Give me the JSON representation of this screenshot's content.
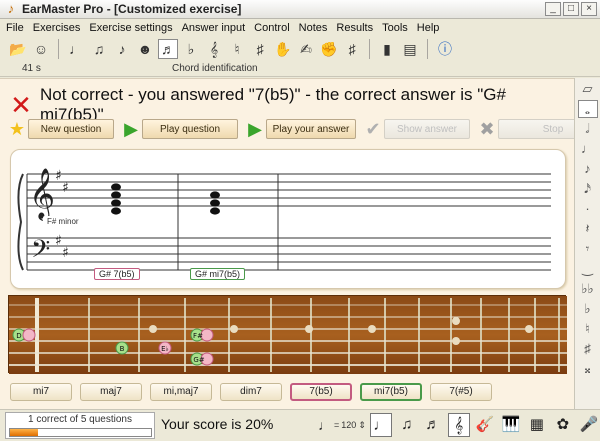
{
  "window": {
    "title": "EarMaster Pro - [Customized exercise]",
    "min": "_",
    "max": "□",
    "close": "×"
  },
  "menu": [
    "File",
    "Exercises",
    "Exercise settings",
    "Answer input",
    "Control",
    "Notes",
    "Results",
    "Tools",
    "Help"
  ],
  "toolbar": {
    "time": "41 s",
    "mode": "Chord identification"
  },
  "status": {
    "message": "Not correct - you answered \"7(b5)\" - the correct answer is \"G# mi7(b5)\""
  },
  "actions": {
    "new_question": "New question",
    "play_question": "Play question",
    "play_answer": "Play your answer",
    "show_answer": "Show answer",
    "stop": "Stop"
  },
  "staff": {
    "key_label": "F# minor",
    "chord_labels": [
      "G# 7(b5)",
      "G# mi7(b5)"
    ]
  },
  "fretboard": {
    "note_labels": [
      "D",
      "B",
      "E♭",
      "F#",
      "G#"
    ]
  },
  "answers": [
    {
      "label": "mi7",
      "state": "normal"
    },
    {
      "label": "maj7",
      "state": "normal"
    },
    {
      "label": "mi,maj7",
      "state": "normal"
    },
    {
      "label": "dim7",
      "state": "normal"
    },
    {
      "label": "7(b5)",
      "state": "wrong"
    },
    {
      "label": "mi7(b5)",
      "state": "right"
    },
    {
      "label": "7(#5)",
      "state": "normal"
    }
  ],
  "score": {
    "summary": "1 correct of 5 questions",
    "progress": 0.2,
    "text": "Your score is 20%",
    "tempo": "120"
  },
  "colors": {
    "wrong": "#c35b80",
    "right": "#4a9a4a",
    "error_icon": "#d21a1a"
  }
}
